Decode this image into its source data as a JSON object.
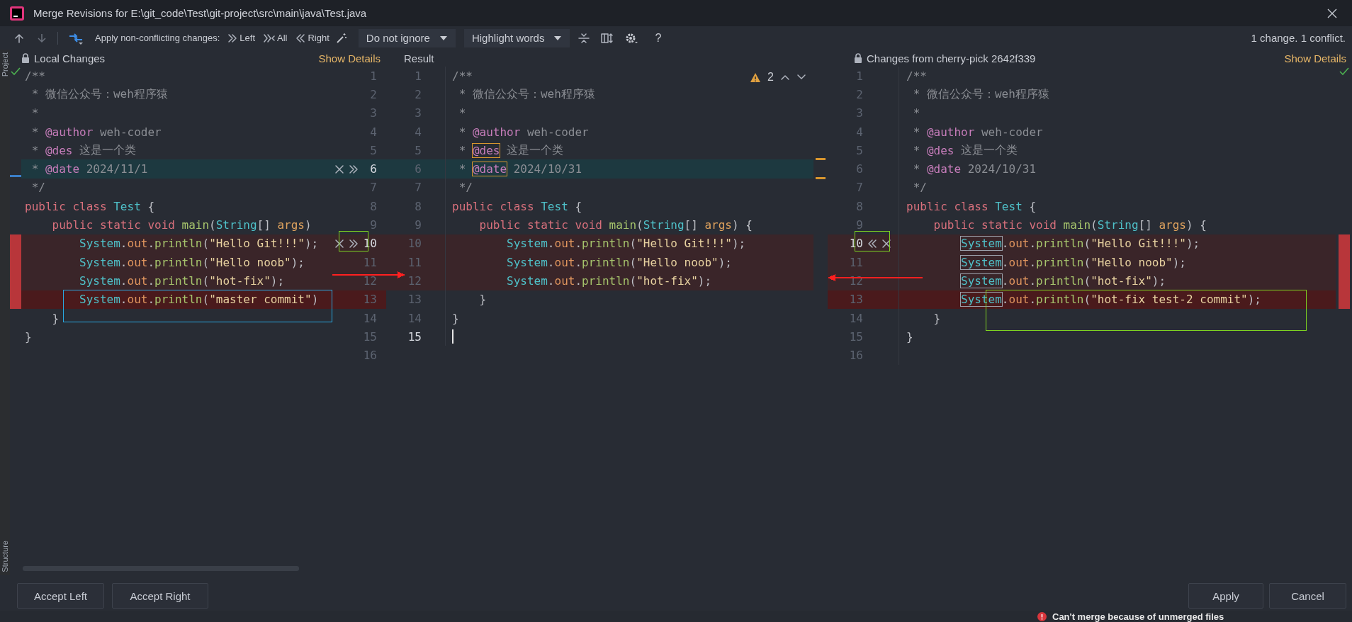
{
  "window": {
    "title": "Merge Revisions for E:\\git_code\\Test\\git-project\\src\\main\\java\\Test.java"
  },
  "side_tabs": [
    {
      "label": "Project"
    },
    {
      "label": "Structure"
    }
  ],
  "toolbar": {
    "apply_label": "Apply non-conflicting changes:",
    "apply_actions": [
      {
        "label": "Left"
      },
      {
        "label": "All"
      },
      {
        "label": "Right"
      }
    ],
    "filters": [
      {
        "label": "Do not ignore"
      },
      {
        "label": "Highlight words"
      }
    ],
    "help": "?",
    "summary": "1 change. 1 conflict."
  },
  "panes": [
    {
      "kind": "left",
      "title": "Local Changes",
      "locked": true,
      "show_details": "Show Details",
      "lines": [
        {
          "n": "1",
          "kind": "plain",
          "current": false,
          "tokens": [
            {
              "kind": "comment",
              "text": "/**"
            }
          ]
        },
        {
          "n": "2",
          "kind": "plain",
          "current": false,
          "tokens": [
            {
              "kind": "comment",
              "text": " * 微信公众号：weh程序猿"
            }
          ]
        },
        {
          "n": "3",
          "kind": "plain",
          "current": false,
          "tokens": [
            {
              "kind": "comment",
              "text": " *"
            }
          ]
        },
        {
          "n": "4",
          "kind": "plain",
          "current": false,
          "tokens": [
            {
              "kind": "comment",
              "text": " * "
            },
            {
              "kind": "tag",
              "text": "@author"
            },
            {
              "kind": "comment",
              "text": " weh-coder"
            }
          ]
        },
        {
          "n": "5",
          "kind": "plain",
          "current": false,
          "tokens": [
            {
              "kind": "comment",
              "text": " * "
            },
            {
              "kind": "tag",
              "text": "@des"
            },
            {
              "kind": "comment",
              "text": " 这是一个类"
            }
          ]
        },
        {
          "n": "6",
          "kind": "changed",
          "current": false,
          "actions": true,
          "tokens": [
            {
              "kind": "comment",
              "text": " * "
            },
            {
              "kind": "tag",
              "text": "@date"
            },
            {
              "kind": "comment",
              "text": " 2024/11/1"
            }
          ]
        },
        {
          "n": "7",
          "kind": "plain",
          "current": false,
          "tokens": [
            {
              "kind": "comment",
              "text": " */"
            }
          ]
        },
        {
          "n": "8",
          "kind": "plain",
          "current": false,
          "tokens": [
            {
              "kind": "keyword",
              "text": "public class "
            },
            {
              "kind": "type",
              "text": "Test"
            },
            {
              "kind": "punct",
              "text": " {"
            }
          ]
        },
        {
          "n": "9",
          "kind": "plain",
          "current": false,
          "tokens": [
            {
              "kind": "keyword",
              "text": "    public static void "
            },
            {
              "kind": "function",
              "text": "main"
            },
            {
              "kind": "punct",
              "text": "("
            },
            {
              "kind": "type",
              "text": "String"
            },
            {
              "kind": "punct",
              "text": "[] "
            },
            {
              "kind": "param",
              "text": "args"
            },
            {
              "kind": "punct",
              "text": ")"
            }
          ]
        },
        {
          "n": "10",
          "kind": "conflict",
          "current": false,
          "actions": true,
          "tokens": [
            {
              "kind": "type",
              "text": "        System"
            },
            {
              "kind": "punct",
              "text": "."
            },
            {
              "kind": "field",
              "text": "out"
            },
            {
              "kind": "punct",
              "text": "."
            },
            {
              "kind": "function",
              "text": "println"
            },
            {
              "kind": "punct",
              "text": "("
            },
            {
              "kind": "string",
              "text": "\"Hello Git!!!\""
            },
            {
              "kind": "punct",
              "text": ");"
            }
          ]
        },
        {
          "n": "11",
          "kind": "conflict",
          "current": false,
          "tokens": [
            {
              "kind": "type",
              "text": "        System"
            },
            {
              "kind": "punct",
              "text": "."
            },
            {
              "kind": "field",
              "text": "out"
            },
            {
              "kind": "punct",
              "text": "."
            },
            {
              "kind": "function",
              "text": "println"
            },
            {
              "kind": "punct",
              "text": "("
            },
            {
              "kind": "string",
              "text": "\"Hello noob\""
            },
            {
              "kind": "punct",
              "text": ");"
            }
          ]
        },
        {
          "n": "12",
          "kind": "conflict",
          "current": false,
          "tokens": [
            {
              "kind": "type",
              "text": "        System"
            },
            {
              "kind": "punct",
              "text": "."
            },
            {
              "kind": "field",
              "text": "out"
            },
            {
              "kind": "punct",
              "text": "."
            },
            {
              "kind": "function",
              "text": "println"
            },
            {
              "kind": "punct",
              "text": "("
            },
            {
              "kind": "string",
              "text": "\"hot-fix\""
            },
            {
              "kind": "punct",
              "text": ");"
            }
          ]
        },
        {
          "n": "13",
          "kind": "inserted",
          "current": false,
          "tokens": [
            {
              "kind": "type",
              "text": "        System"
            },
            {
              "kind": "punct",
              "text": "."
            },
            {
              "kind": "field",
              "text": "out"
            },
            {
              "kind": "punct",
              "text": "."
            },
            {
              "kind": "function",
              "text": "println"
            },
            {
              "kind": "punct",
              "text": "("
            },
            {
              "kind": "string",
              "text": "\"master commit\""
            },
            {
              "kind": "punct",
              "text": ")"
            }
          ]
        },
        {
          "n": "14",
          "kind": "plain",
          "current": false,
          "tokens": [
            {
              "kind": "punct",
              "text": "    }"
            }
          ]
        },
        {
          "n": "15",
          "kind": "plain",
          "current": false,
          "tokens": [
            {
              "kind": "punct",
              "text": "}"
            }
          ]
        },
        {
          "n": "16",
          "kind": "plain",
          "current": false
        }
      ]
    },
    {
      "kind": "mid",
      "title": "Result",
      "locked": false,
      "warnings": "2",
      "lines": [
        {
          "n": "1",
          "kind": "plain",
          "current": false,
          "tokens": [
            {
              "kind": "comment",
              "text": "/**"
            }
          ]
        },
        {
          "n": "2",
          "kind": "plain",
          "current": false,
          "tokens": [
            {
              "kind": "comment",
              "text": " * 微信公众号：weh程序猿"
            }
          ]
        },
        {
          "n": "3",
          "kind": "plain",
          "current": false,
          "tokens": [
            {
              "kind": "comment",
              "text": " *"
            }
          ]
        },
        {
          "n": "4",
          "kind": "plain",
          "current": false,
          "tokens": [
            {
              "kind": "comment",
              "text": " * "
            },
            {
              "kind": "tag",
              "text": "@author"
            },
            {
              "kind": "comment",
              "text": " weh-coder"
            }
          ]
        },
        {
          "n": "5",
          "kind": "plain",
          "current": false,
          "tokens": [
            {
              "kind": "comment",
              "text": " * "
            },
            {
              "kind": "tag",
              "text": "@des",
              "color": "#d8962e"
            },
            {
              "kind": "comment",
              "text": " 这是一个类"
            }
          ]
        },
        {
          "n": "6",
          "kind": "changed",
          "current": false,
          "tokens": [
            {
              "kind": "comment",
              "text": " * "
            },
            {
              "kind": "tag",
              "text": "@date",
              "color": "#d8962e"
            },
            {
              "kind": "comment",
              "text": " 2024/10/31"
            }
          ]
        },
        {
          "n": "7",
          "kind": "plain",
          "current": false,
          "tokens": [
            {
              "kind": "comment",
              "text": " */"
            }
          ]
        },
        {
          "n": "8",
          "kind": "plain",
          "current": false,
          "tokens": [
            {
              "kind": "keyword",
              "text": "public class "
            },
            {
              "kind": "type",
              "text": "Test"
            },
            {
              "kind": "punct",
              "text": " {"
            }
          ]
        },
        {
          "n": "9",
          "kind": "plain",
          "current": false,
          "tokens": [
            {
              "kind": "keyword",
              "text": "    public static void "
            },
            {
              "kind": "function",
              "text": "main"
            },
            {
              "kind": "punct",
              "text": "("
            },
            {
              "kind": "type",
              "text": "String"
            },
            {
              "kind": "punct",
              "text": "[] "
            },
            {
              "kind": "param",
              "text": "args"
            },
            {
              "kind": "punct",
              "text": ") {"
            }
          ]
        },
        {
          "n": "10",
          "kind": "conflict",
          "current": false,
          "tokens": [
            {
              "kind": "type",
              "text": "        System"
            },
            {
              "kind": "punct",
              "text": "."
            },
            {
              "kind": "field",
              "text": "out"
            },
            {
              "kind": "punct",
              "text": "."
            },
            {
              "kind": "function",
              "text": "println"
            },
            {
              "kind": "punct",
              "text": "("
            },
            {
              "kind": "string",
              "text": "\"Hello Git!!!\""
            },
            {
              "kind": "punct",
              "text": ");"
            }
          ]
        },
        {
          "n": "11",
          "kind": "conflict",
          "current": false,
          "tokens": [
            {
              "kind": "type",
              "text": "        System"
            },
            {
              "kind": "punct",
              "text": "."
            },
            {
              "kind": "field",
              "text": "out"
            },
            {
              "kind": "punct",
              "text": "."
            },
            {
              "kind": "function",
              "text": "println"
            },
            {
              "kind": "punct",
              "text": "("
            },
            {
              "kind": "string",
              "text": "\"Hello noob\""
            },
            {
              "kind": "punct",
              "text": ");"
            }
          ]
        },
        {
          "n": "12",
          "kind": "conflict",
          "current": false,
          "tokens": [
            {
              "kind": "type",
              "text": "        System"
            },
            {
              "kind": "punct",
              "text": "."
            },
            {
              "kind": "field",
              "text": "out"
            },
            {
              "kind": "punct",
              "text": "."
            },
            {
              "kind": "function",
              "text": "println"
            },
            {
              "kind": "punct",
              "text": "("
            },
            {
              "kind": "string",
              "text": "\"hot-fix\""
            },
            {
              "kind": "punct",
              "text": ");"
            }
          ]
        },
        {
          "n": "13",
          "kind": "plain",
          "current": false,
          "tokens": [
            {
              "kind": "punct",
              "text": "    }"
            }
          ]
        },
        {
          "n": "14",
          "kind": "plain",
          "current": false,
          "tokens": [
            {
              "kind": "punct",
              "text": "}"
            }
          ]
        },
        {
          "n": "15",
          "kind": "plain",
          "current": true
        }
      ]
    },
    {
      "kind": "right",
      "title": "Changes from cherry-pick 2642f339",
      "locked": true,
      "show_details": "Show Details",
      "lines": [
        {
          "n": "1",
          "kind": "plain",
          "current": false,
          "tokens": [
            {
              "kind": "comment",
              "text": "/**"
            }
          ]
        },
        {
          "n": "2",
          "kind": "plain",
          "current": false,
          "tokens": [
            {
              "kind": "comment",
              "text": " * 微信公众号：weh程序猿"
            }
          ]
        },
        {
          "n": "3",
          "kind": "plain",
          "current": false,
          "tokens": [
            {
              "kind": "comment",
              "text": " *"
            }
          ]
        },
        {
          "n": "4",
          "kind": "plain",
          "current": false,
          "tokens": [
            {
              "kind": "comment",
              "text": " * "
            },
            {
              "kind": "tag",
              "text": "@author"
            },
            {
              "kind": "comment",
              "text": " weh-coder"
            }
          ]
        },
        {
          "n": "5",
          "kind": "plain",
          "current": false,
          "tokens": [
            {
              "kind": "comment",
              "text": " * "
            },
            {
              "kind": "tag",
              "text": "@des"
            },
            {
              "kind": "comment",
              "text": " 这是一个类"
            }
          ]
        },
        {
          "n": "6",
          "kind": "plain",
          "current": false,
          "tokens": [
            {
              "kind": "comment",
              "text": " * "
            },
            {
              "kind": "tag",
              "text": "@date"
            },
            {
              "kind": "comment",
              "text": " 2024/10/31"
            }
          ]
        },
        {
          "n": "7",
          "kind": "plain",
          "current": false,
          "tokens": [
            {
              "kind": "comment",
              "text": " */"
            }
          ]
        },
        {
          "n": "8",
          "kind": "plain",
          "current": false,
          "tokens": [
            {
              "kind": "keyword",
              "text": "public class "
            },
            {
              "kind": "type",
              "text": "Test"
            },
            {
              "kind": "punct",
              "text": " {"
            }
          ]
        },
        {
          "n": "9",
          "kind": "plain",
          "current": false,
          "tokens": [
            {
              "kind": "keyword",
              "text": "    public static void "
            },
            {
              "kind": "function",
              "text": "main"
            },
            {
              "kind": "punct",
              "text": "("
            },
            {
              "kind": "type",
              "text": "String"
            },
            {
              "kind": "punct",
              "text": "[] "
            },
            {
              "kind": "param",
              "text": "args"
            },
            {
              "kind": "punct",
              "text": ") {"
            }
          ]
        },
        {
          "n": "10",
          "kind": "conflict",
          "current": false,
          "actions": true,
          "tokens": [
            {
              "kind": "type",
              "text": "        System",
              "color": "#9aa0aa"
            },
            {
              "kind": "punct",
              "text": "."
            },
            {
              "kind": "field",
              "text": "out"
            },
            {
              "kind": "punct",
              "text": "."
            },
            {
              "kind": "function",
              "text": "println"
            },
            {
              "kind": "punct",
              "text": "("
            },
            {
              "kind": "string",
              "text": "\"Hello Git!!!\""
            },
            {
              "kind": "punct",
              "text": ");"
            }
          ]
        },
        {
          "n": "11",
          "kind": "conflict",
          "current": false,
          "tokens": [
            {
              "kind": "type",
              "text": "        System",
              "color": "#9aa0aa"
            },
            {
              "kind": "punct",
              "text": "."
            },
            {
              "kind": "field",
              "text": "out"
            },
            {
              "kind": "punct",
              "text": "."
            },
            {
              "kind": "function",
              "text": "println"
            },
            {
              "kind": "punct",
              "text": "("
            },
            {
              "kind": "string",
              "text": "\"Hello noob\""
            },
            {
              "kind": "punct",
              "text": ");"
            }
          ]
        },
        {
          "n": "12",
          "kind": "conflict",
          "current": false,
          "tokens": [
            {
              "kind": "type",
              "text": "        System",
              "color": "#9aa0aa"
            },
            {
              "kind": "punct",
              "text": "."
            },
            {
              "kind": "field",
              "text": "out"
            },
            {
              "kind": "punct",
              "text": "."
            },
            {
              "kind": "function",
              "text": "println"
            },
            {
              "kind": "punct",
              "text": "("
            },
            {
              "kind": "string",
              "text": "\"hot-fix\""
            },
            {
              "kind": "punct",
              "text": ");"
            }
          ]
        },
        {
          "n": "13",
          "kind": "inserted",
          "current": false,
          "tokens": [
            {
              "kind": "type",
              "text": "        System",
              "color": "#9aa0aa"
            },
            {
              "kind": "punct",
              "text": "."
            },
            {
              "kind": "field",
              "text": "out"
            },
            {
              "kind": "punct",
              "text": "."
            },
            {
              "kind": "function",
              "text": "println"
            },
            {
              "kind": "punct",
              "text": "("
            },
            {
              "kind": "string",
              "text": "\"hot-fix test-2 commit\""
            },
            {
              "kind": "punct",
              "text": ");"
            }
          ]
        },
        {
          "n": "14",
          "kind": "plain",
          "current": false,
          "tokens": [
            {
              "kind": "punct",
              "text": "    }"
            }
          ]
        },
        {
          "n": "15",
          "kind": "plain",
          "current": false,
          "tokens": [
            {
              "kind": "punct",
              "text": "}"
            }
          ]
        },
        {
          "n": "16",
          "kind": "plain",
          "current": false
        }
      ]
    }
  ],
  "annotations": [
    {
      "kind": "frame",
      "color": "#29a8e0"
    },
    {
      "kind": "frame",
      "color": "#7ed321"
    },
    {
      "kind": "frame",
      "color": "#7ed321"
    },
    {
      "kind": "frame",
      "color": "#7ed321"
    },
    {
      "kind": "arrow",
      "color": "#ff2020"
    },
    {
      "kind": "arrow",
      "color": "#ff2020"
    }
  ],
  "bottom": {
    "left_buttons": [
      {
        "label": "Accept Left"
      },
      {
        "label": "Accept Right"
      }
    ],
    "right_buttons": [
      {
        "label": "Apply"
      },
      {
        "label": "Cancel"
      }
    ]
  },
  "status": {
    "message": "Can't merge because of unmerged files"
  }
}
